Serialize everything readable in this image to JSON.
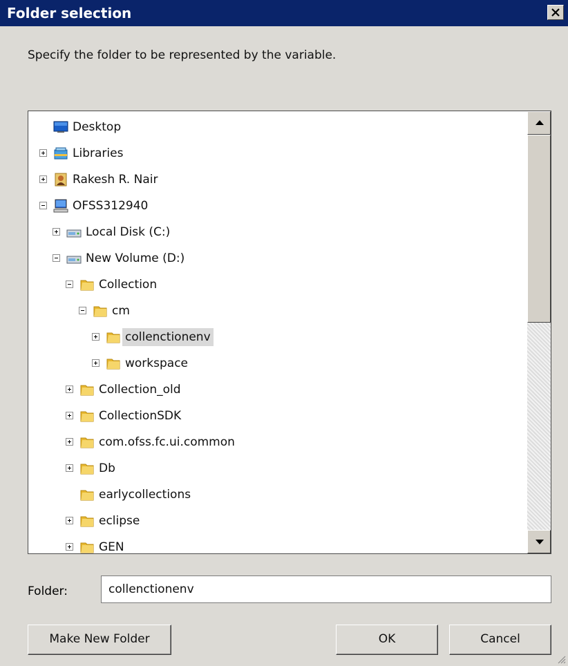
{
  "window": {
    "title": "Folder selection"
  },
  "instruction": "Specify the folder to be represented by the variable.",
  "tree": {
    "nodes": [
      {
        "label": "Desktop",
        "icon": "desktop-icon",
        "expander": "none"
      },
      {
        "label": "Libraries",
        "icon": "libraries-icon",
        "expander": "plus"
      },
      {
        "label": "Rakesh R. Nair",
        "icon": "user-icon",
        "expander": "plus"
      },
      {
        "label": "OFSS312940",
        "icon": "computer-icon",
        "expander": "minus"
      },
      {
        "label": "Local Disk (C:)",
        "icon": "drive-icon",
        "expander": "plus"
      },
      {
        "label": "New Volume (D:)",
        "icon": "drive-icon",
        "expander": "minus"
      },
      {
        "label": "Collection",
        "icon": "folder-icon",
        "expander": "minus"
      },
      {
        "label": "cm",
        "icon": "folder-icon",
        "expander": "minus"
      },
      {
        "label": "collenctionenv",
        "icon": "folder-icon",
        "expander": "plus",
        "selected": true
      },
      {
        "label": "workspace",
        "icon": "folder-icon",
        "expander": "plus"
      },
      {
        "label": "Collection_old",
        "icon": "folder-icon",
        "expander": "plus"
      },
      {
        "label": "CollectionSDK",
        "icon": "folder-icon",
        "expander": "plus"
      },
      {
        "label": "com.ofss.fc.ui.common",
        "icon": "folder-icon",
        "expander": "plus"
      },
      {
        "label": "Db",
        "icon": "folder-icon",
        "expander": "plus"
      },
      {
        "label": "earlycollections",
        "icon": "folder-icon",
        "expander": "none"
      },
      {
        "label": "eclipse",
        "icon": "folder-icon",
        "expander": "plus"
      },
      {
        "label": "GEN",
        "icon": "folder-icon",
        "expander": "plus"
      }
    ]
  },
  "folder_field": {
    "label": "Folder:",
    "value": "collenctionenv"
  },
  "buttons": {
    "make_new_folder": "Make New Folder",
    "ok": "OK",
    "cancel": "Cancel"
  },
  "colors": {
    "titlebar": "#0a246a",
    "selection": "#d9d9d9",
    "folder": "#e8b830"
  }
}
